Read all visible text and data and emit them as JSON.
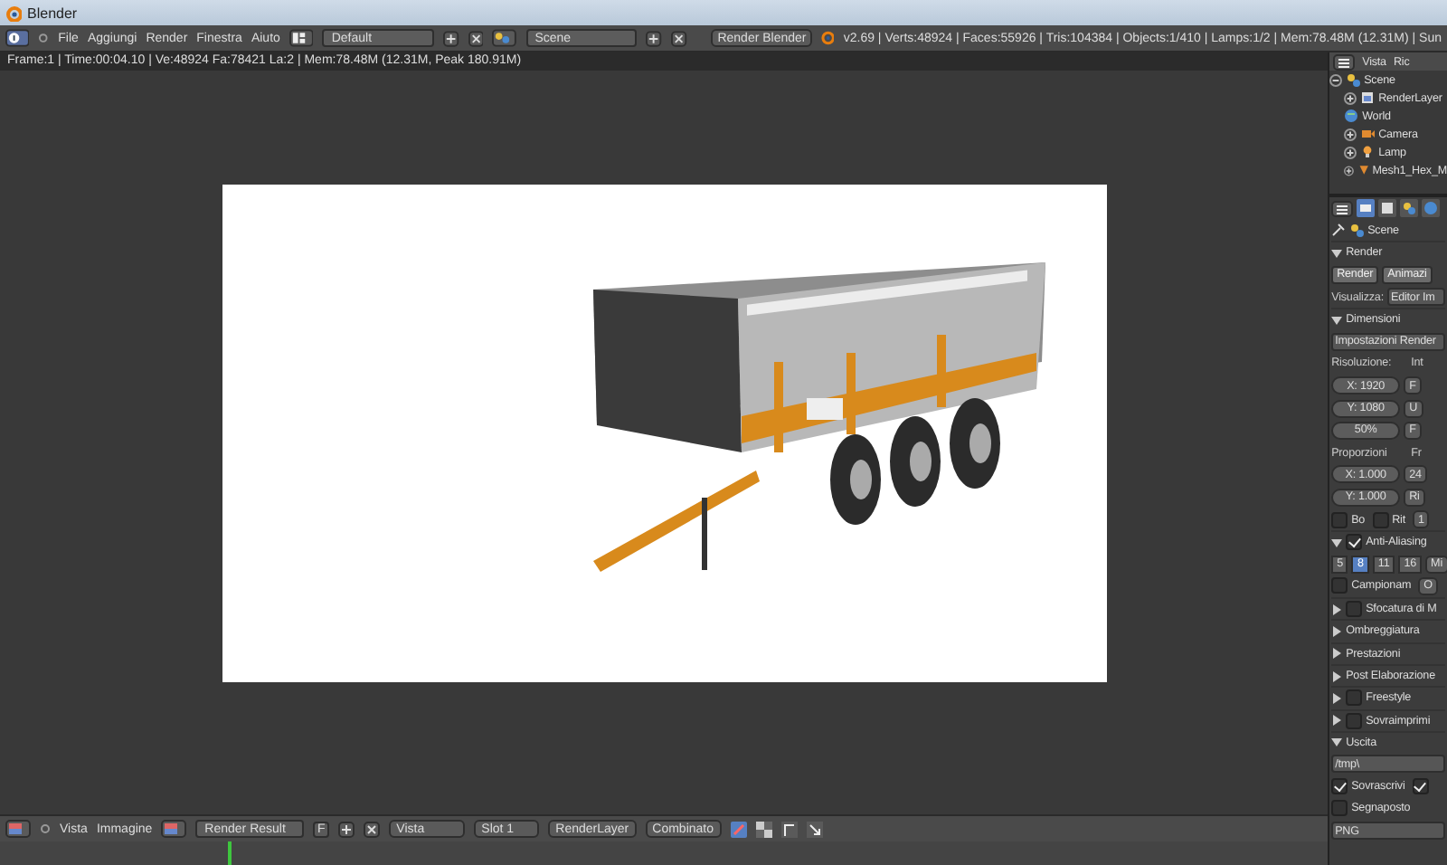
{
  "window": {
    "title": "Blender"
  },
  "menubar": {
    "menus": [
      "File",
      "Aggiungi",
      "Render",
      "Finestra",
      "Aiuto"
    ],
    "layout": "Default",
    "scene": "Scene",
    "engine": "Render Blender",
    "stats": "v2.69 | Verts:48924 | Faces:55926 | Tris:104384 | Objects:1/410 | Lamps:1/2 | Mem:78.48M (12.31M) | Sun"
  },
  "render_info": "Frame:1 | Time:00:04.10 | Ve:48924 Fa:78421 La:2 | Mem:78.48M (12.31M, Peak 180.91M)",
  "outliner": {
    "menus": [
      "Vista",
      "Ric"
    ],
    "items": [
      {
        "kind": "scene",
        "label": "Scene",
        "expanded": true,
        "children": [
          {
            "kind": "layers",
            "label": "RenderLayer",
            "expanded": false
          },
          {
            "kind": "world",
            "label": "World"
          },
          {
            "kind": "camera",
            "label": "Camera",
            "expanded": false
          },
          {
            "kind": "lamp",
            "label": "Lamp",
            "expanded": false
          },
          {
            "kind": "mesh",
            "label": "Mesh1_Hex_M",
            "expanded": false
          }
        ]
      }
    ]
  },
  "properties": {
    "context": "Scene",
    "rows": [
      {
        "kind": "header",
        "label": "Render",
        "expanded": true
      },
      {
        "kind": "buttons",
        "items": [
          "Render",
          "Animazi"
        ]
      },
      {
        "kind": "labeled",
        "label": "Visualizza:",
        "value": "Editor Im"
      },
      {
        "kind": "header",
        "label": "Dimensioni",
        "expanded": true
      },
      {
        "kind": "dropdown",
        "value": "Impostazioni Render"
      },
      {
        "kind": "caption",
        "label": "Risoluzione:",
        "side": "Int"
      },
      {
        "kind": "number",
        "value": "X: 1920",
        "side": "F"
      },
      {
        "kind": "number",
        "value": "Y: 1080",
        "side": "U"
      },
      {
        "kind": "number",
        "value": "50%",
        "side": "F"
      },
      {
        "kind": "caption",
        "label": "Proporzioni",
        "side": "Fr"
      },
      {
        "kind": "number",
        "value": "X: 1.000",
        "side": "24"
      },
      {
        "kind": "number",
        "value": "Y: 1.000",
        "side": "Ri"
      },
      {
        "kind": "checks",
        "items": [
          {
            "label": "Bo",
            "checked": false
          },
          {
            "label": "Rit",
            "checked": false
          }
        ],
        "side": "1"
      },
      {
        "kind": "header",
        "label": "Anti-Aliasing",
        "expanded": true,
        "checked": true
      },
      {
        "kind": "segments",
        "items": [
          {
            "label": "5",
            "selected": false
          },
          {
            "label": "8",
            "selected": true
          },
          {
            "label": "11",
            "selected": false
          },
          {
            "label": "16",
            "selected": false
          }
        ],
        "side": "Mi"
      },
      {
        "kind": "checks",
        "items": [
          {
            "label": "Campionam",
            "checked": false
          }
        ],
        "side": "O"
      },
      {
        "kind": "header",
        "label": "Sfocatura di M",
        "expanded": false,
        "checked": false
      },
      {
        "kind": "header",
        "label": "Ombreggiatura",
        "expanded": false
      },
      {
        "kind": "header",
        "label": "Prestazioni",
        "expanded": false
      },
      {
        "kind": "header",
        "label": "Post Elaborazione",
        "expanded": false
      },
      {
        "kind": "header",
        "label": "Freestyle",
        "expanded": false,
        "checked": false
      },
      {
        "kind": "header",
        "label": "Sovraimprimi",
        "expanded": false,
        "checked": false
      },
      {
        "kind": "header",
        "label": "Uscita",
        "expanded": true
      },
      {
        "kind": "path",
        "value": "/tmp\\"
      },
      {
        "kind": "checks",
        "items": [
          {
            "label": "Sovrascrivi",
            "checked": true
          },
          {
            "checked": true
          }
        ]
      },
      {
        "kind": "checks",
        "items": [
          {
            "label": "Segnaposto",
            "checked": false
          }
        ]
      },
      {
        "kind": "dropdown",
        "value": "PNG"
      }
    ]
  },
  "image_header": {
    "menus": [
      "Vista",
      "Immagine"
    ],
    "image": "Render Result",
    "fake_user": "F",
    "view": "Vista",
    "slot": "Slot 1",
    "layer": "RenderLayer",
    "pass": "Combinato"
  }
}
